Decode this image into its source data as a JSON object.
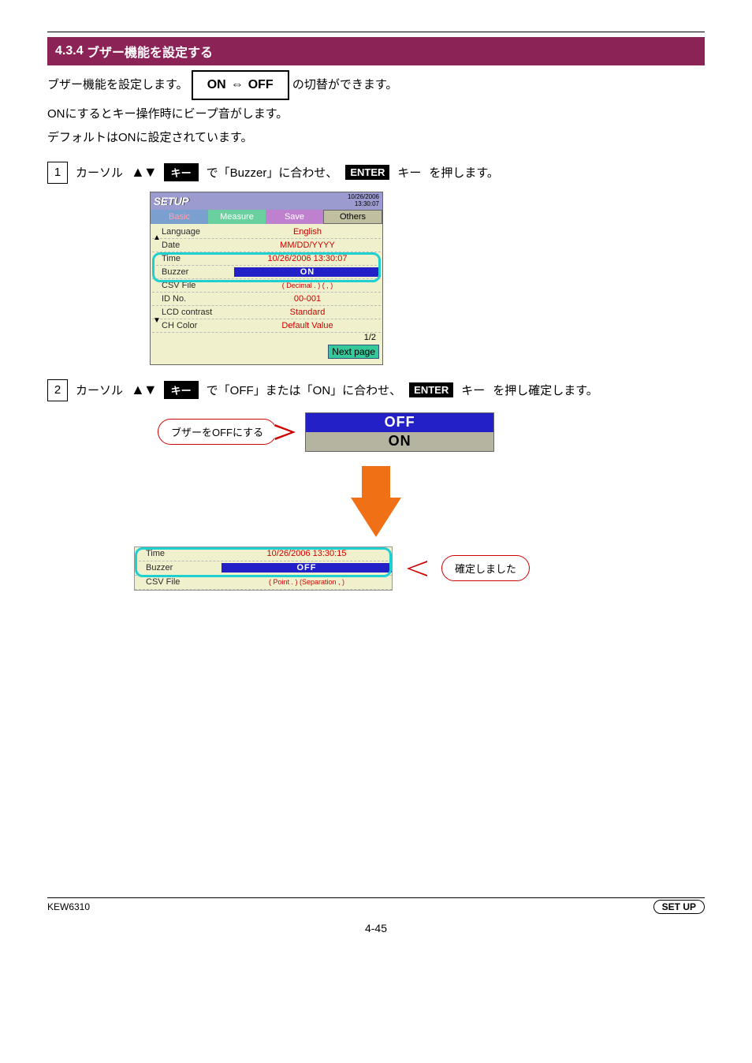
{
  "section": {
    "number": "4.3.4",
    "title": "ブザー機能を設定する"
  },
  "intro": {
    "line1_pre": "ブザー機能を設定します。",
    "box_left": "ON",
    "box_right": "OFF",
    "line1_post": "の切替ができます。",
    "line2": "ONにするとキー操作時にビープ音がします。",
    "line3": "デフォルトはONに設定されています。"
  },
  "step1": {
    "num": "1",
    "pre": "カーソル",
    "key1": "キー",
    "mid": "で「Buzzer」に合わせ、",
    "enter": "ENTER",
    "key2": "キー",
    "post": "を押します。"
  },
  "device": {
    "logo": "SETUP",
    "stamp_date": "10/26/2006",
    "stamp_time": "13:30:07",
    "tabs": {
      "basic": "Basic",
      "meas": "Measure",
      "save": "Save",
      "others": "Others"
    },
    "rows": [
      {
        "label": "Language",
        "value": "English",
        "cls": "val-red"
      },
      {
        "label": "Date",
        "value": "MM/DD/YYYY",
        "cls": "val-red"
      },
      {
        "label": "Time",
        "value": "10/26/2006 13:30:07",
        "cls": "val-red"
      },
      {
        "label": "Buzzer",
        "value": "ON",
        "cls": "val-blue-bg"
      },
      {
        "label": "CSV File",
        "value": "( Decimal  . ) (           , )",
        "cls": "val-red",
        "small": true
      },
      {
        "label": "ID No.",
        "value": "00-001",
        "cls": "val-red"
      },
      {
        "label": "LCD contrast",
        "value": "Standard",
        "cls": "val-red"
      },
      {
        "label": "CH Color",
        "value": "Default Value",
        "cls": "val-red"
      }
    ],
    "pagecount": "1/2",
    "nextpage": "Next page"
  },
  "step2": {
    "num": "2",
    "pre": "カーソル",
    "key1": "キー",
    "mid": "で「OFF」または「ON」に合わせ、",
    "enter": "ENTER",
    "key2": "キー",
    "post": "を押し確定します。"
  },
  "popup": {
    "callout": "ブザーをOFFにする",
    "off": "OFF",
    "on": "ON"
  },
  "device2": {
    "rows": [
      {
        "label": "Time",
        "value": "10/26/2006 13:30:15",
        "cls": "val-red"
      },
      {
        "label": "Buzzer",
        "value": "OFF",
        "cls": "val-blue-bg"
      },
      {
        "label": "CSV File",
        "value": "(   Point   . ) (Separation , )",
        "cls": "val-red",
        "small": true
      }
    ],
    "callout": "確定しました"
  },
  "footer": {
    "left": "KEW6310",
    "right_pill": "SET UP",
    "pageno": "4-45"
  }
}
